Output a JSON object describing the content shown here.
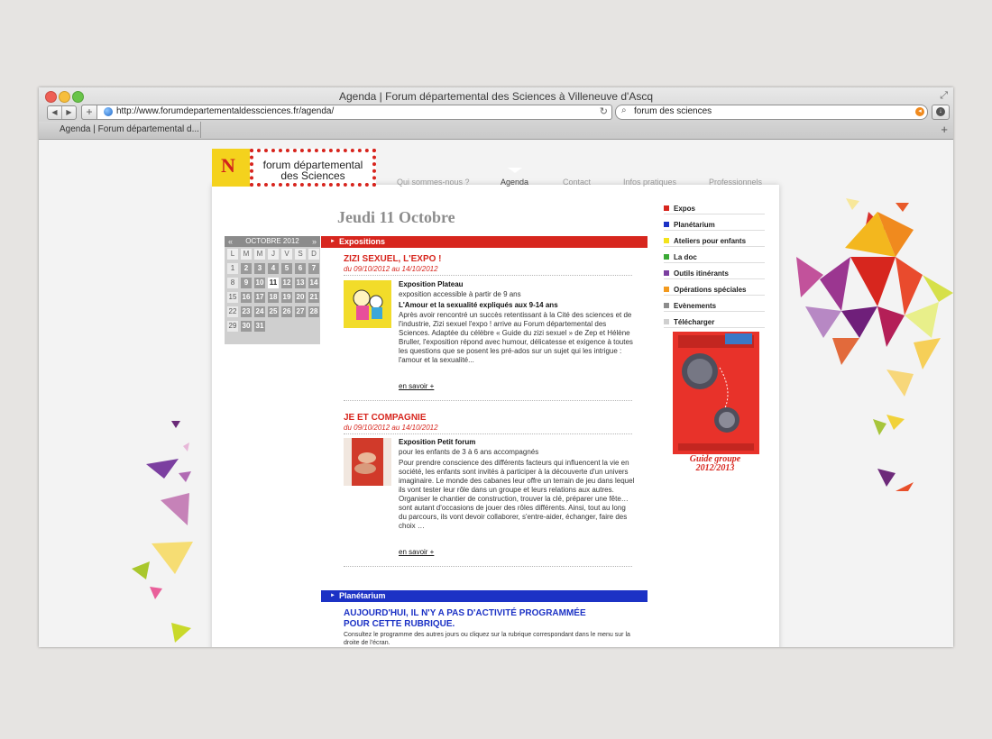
{
  "browser": {
    "window_title": "Agenda | Forum départemental des Sciences à Villeneuve d'Ascq",
    "nav_back": "◀",
    "nav_forward": "▶",
    "url": "http://www.forumdepartementaldessciences.fr/agenda/",
    "search_value": "forum des sciences",
    "tab_label": "Agenda | Forum départemental d...",
    "new_tab": "+"
  },
  "site": {
    "logo_letter": "N",
    "logo_text_line1": "forum départemental",
    "logo_text_line2": "des Sciences",
    "menu": [
      {
        "label": "Qui sommes-nous ?"
      },
      {
        "label": "Agenda"
      },
      {
        "label": "Contact"
      },
      {
        "label": "Infos pratiques"
      },
      {
        "label": "Professionnels"
      }
    ],
    "date_title": "Jeudi 11 Octobre",
    "calendar": {
      "prev": "«",
      "month": "OCTOBRE 2012",
      "next": "»",
      "days": [
        "L",
        "M",
        "M",
        "J",
        "V",
        "S",
        "D"
      ],
      "rows": [
        [
          "1",
          "2",
          "3",
          "4",
          "5",
          "6",
          "7"
        ],
        [
          "8",
          "9",
          "10",
          "11",
          "12",
          "13",
          "14"
        ],
        [
          "15",
          "16",
          "17",
          "18",
          "19",
          "20",
          "21"
        ],
        [
          "22",
          "23",
          "24",
          "25",
          "26",
          "27",
          "28"
        ],
        [
          "29",
          "30",
          "31",
          "",
          "",
          "",
          ""
        ]
      ]
    },
    "sections": {
      "expos": {
        "label": "Expositions",
        "color": "#d7261e",
        "events": [
          {
            "title": "ZIZI SEXUEL, L'EXPO !",
            "dates": "du 09/10/2012 au 14/10/2012",
            "subtitle": "Exposition Plateau",
            "audience": "exposition accessible à partir de 9 ans",
            "tagline": "L'Amour et la sexualité expliqués aux 9-14 ans",
            "body": "Après avoir rencontré un succès retentissant à la Cité des sciences et de l'industrie, Zizi sexuel l'expo ! arrive au Forum départemental des Sciences. Adaptée du célèbre « Guide du zizi sexuel » de Zep et Hélène Bruller, l'exposition répond avec humour, délicatesse et exigence à toutes les questions que se posent les pré-ados sur un sujet qui les intrigue : l'amour et la sexualité...",
            "more": "en savoir +"
          },
          {
            "title": "JE ET COMPAGNIE",
            "dates": "du 09/10/2012 au 14/10/2012",
            "subtitle": "Exposition Petit forum",
            "audience": "pour les enfants de 3 à 6 ans accompagnés",
            "body": "Pour prendre conscience des différents facteurs qui influencent la vie en société, les enfants sont invités à participer à la découverte d'un univers imaginaire. Le monde des cabanes leur offre un terrain de jeu dans lequel ils vont tester leur rôle dans un groupe et leurs relations aux autres. Organiser le chantier de construction, trouver la clé, préparer une fête… sont autant d'occasions de jouer des rôles différents. Ainsi, tout au long du parcours, ils vont devoir collaborer, s'entre-aider, échanger, faire des choix …",
            "more": "en savoir +"
          }
        ]
      },
      "planetarium": {
        "label": "Planétarium",
        "color": "#1c32c5",
        "empty_title": "AUJOURD'HUI, IL N'Y A PAS D'ACTIVITÉ PROGRAMMÉE POUR CETTE RUBRIQUE.",
        "empty_text": "Consultez le programme des autres jours ou cliquez sur la rubrique correspondant dans le menu sur la droite de l'écran."
      }
    },
    "right_nav": [
      {
        "label": "Expos",
        "color": "#d7261e"
      },
      {
        "label": "Planétarium",
        "color": "#1c32c5"
      },
      {
        "label": "Ateliers pour enfants",
        "color": "#f3e31b"
      },
      {
        "label": "La doc",
        "color": "#3aa935"
      },
      {
        "label": "Outils itinérants",
        "color": "#7b3fa0"
      },
      {
        "label": "Opérations spéciales",
        "color": "#f39a1e"
      },
      {
        "label": "Evènements",
        "color": "#8c8c8c"
      },
      {
        "label": "Télécharger",
        "color": "#cfcfcf"
      }
    ],
    "guide": {
      "label_line1": "Guide groupe",
      "label_line2": "2012/2013"
    }
  }
}
